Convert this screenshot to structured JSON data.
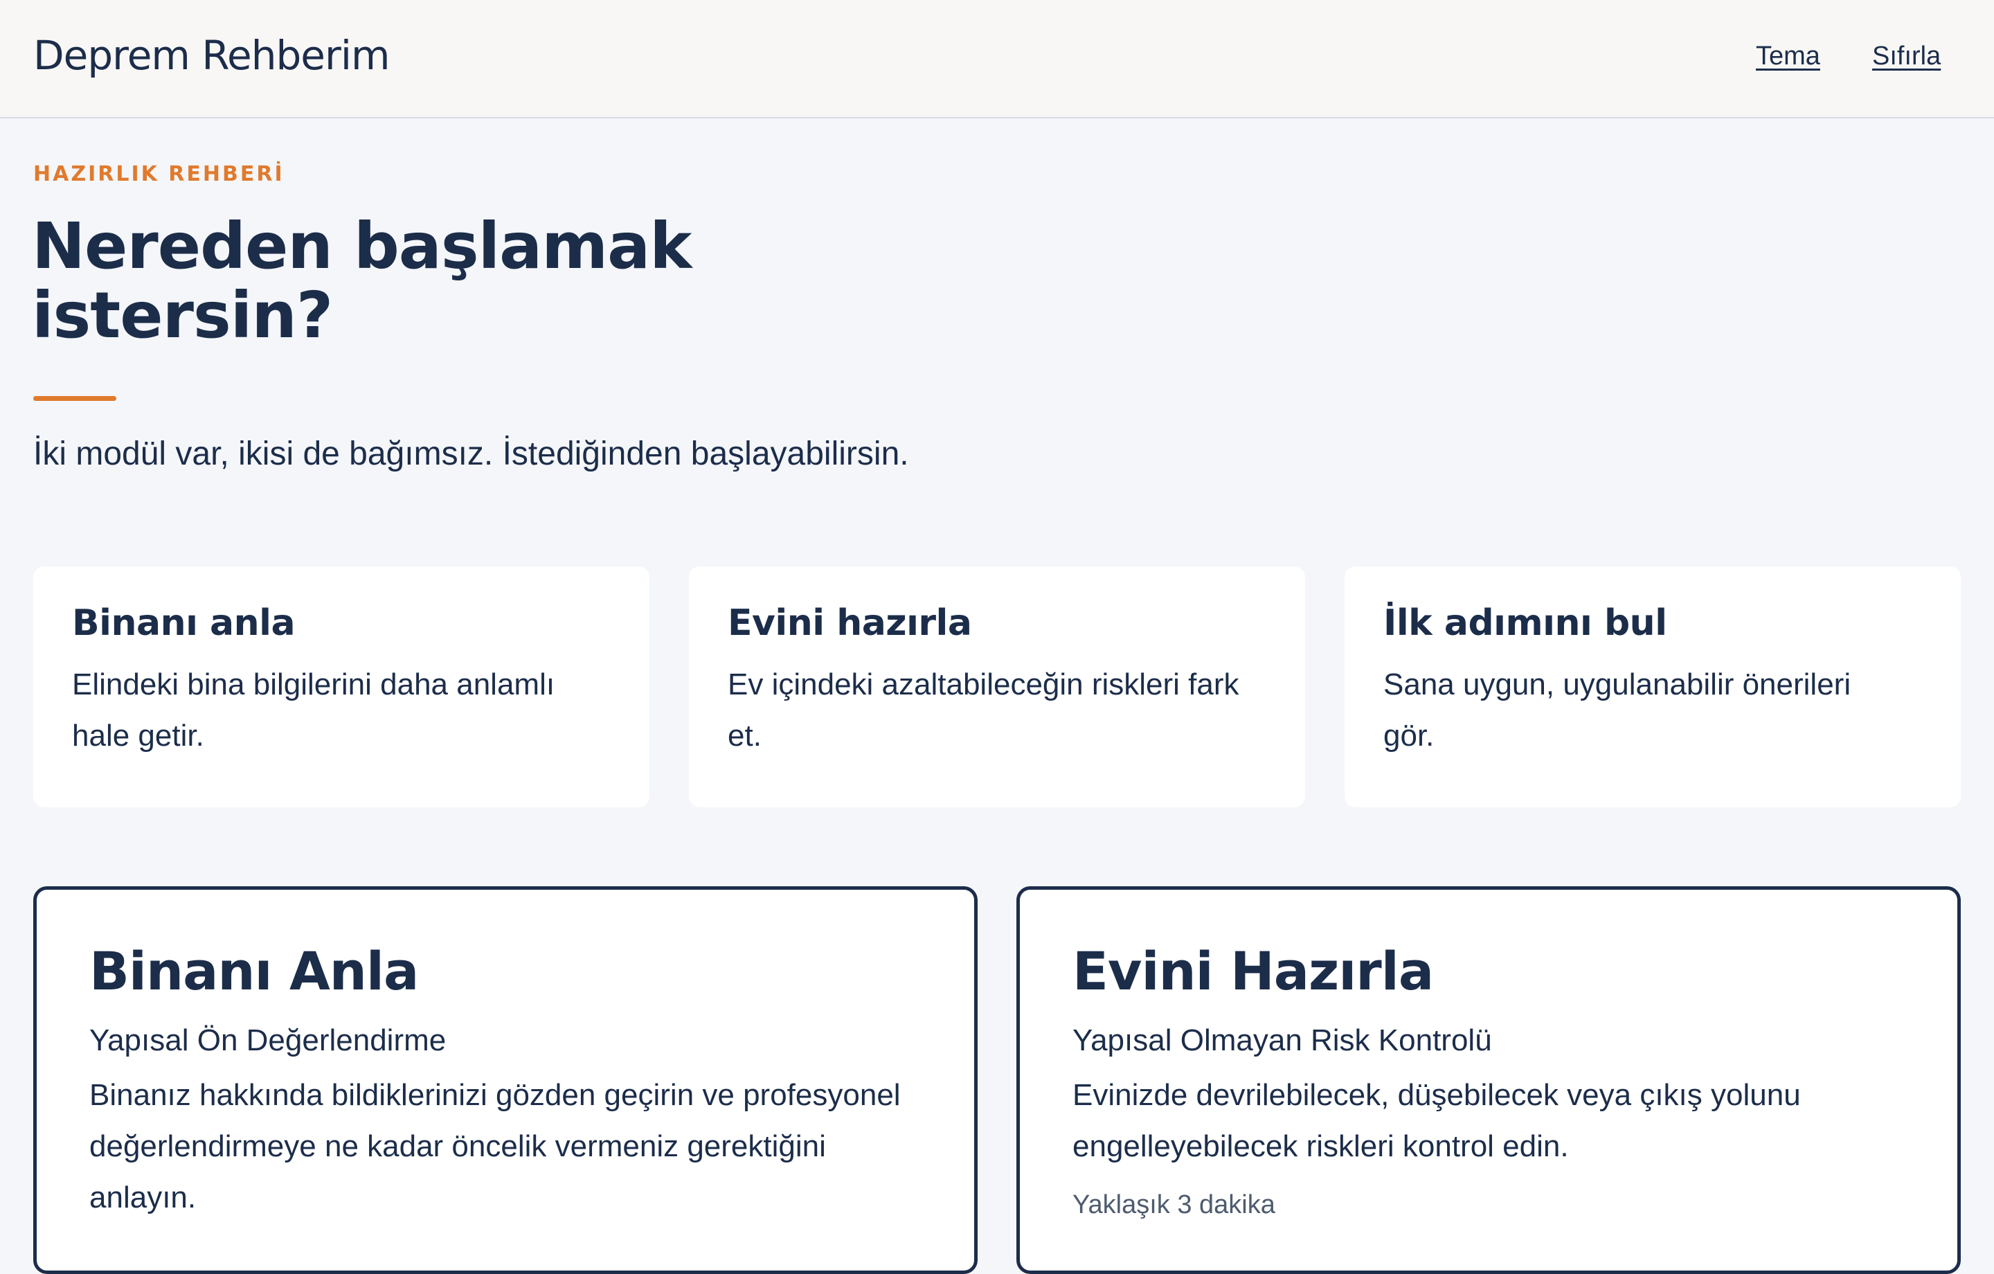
{
  "header": {
    "brand": "Deprem Rehberim",
    "nav": {
      "theme": "Tema",
      "reset": "Sıfırla"
    }
  },
  "hero": {
    "eyebrow": "HAZIRLIK REHBERİ",
    "title": "Nereden başlamak istersin?",
    "lead": "İki modül var, ikisi de bağımsız. İstediğinden başlayabilirsin."
  },
  "info_cards": [
    {
      "title": "Binanı anla",
      "text": "Elindeki bina bilgilerini daha anlamlı hale getir."
    },
    {
      "title": "Evini hazırla",
      "text": "Ev içindeki azaltabileceğin riskleri fark et."
    },
    {
      "title": "İlk adımını bul",
      "text": "Sana uygun, uygulanabilir önerileri gör."
    }
  ],
  "modules": [
    {
      "title": "Binanı Anla",
      "subtitle": "Yapısal Ön Değerlendirme",
      "description": "Binanız hakkında bildiklerinizi gözden geçirin ve profesyonel değerlendirmeye ne kadar öncelik vermeniz gerektiğini anlayın.",
      "meta": ""
    },
    {
      "title": "Evini Hazırla",
      "subtitle": "Yapısal Olmayan Risk Kontrolü",
      "description": "Evinizde devrilebilecek, düşebilecek veya çıkış yolunu engelleyebilecek riskleri kontrol edin.",
      "meta": "Yaklaşık 3 dakika"
    }
  ],
  "colors": {
    "navy": "#1c2d4a",
    "accent": "#e07a2e",
    "background": "#f4f6f9",
    "header_bg": "#f8f7f6",
    "card_bg": "#ffffff",
    "muted": "#4e5b6f"
  }
}
